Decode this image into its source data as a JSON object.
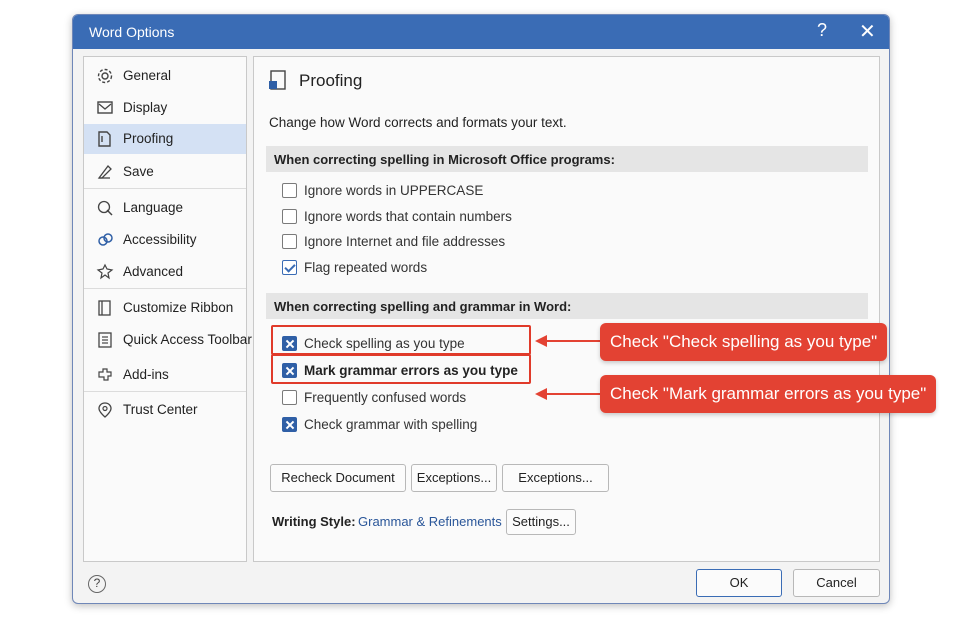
{
  "dialog": {
    "title": "Word Options",
    "help_glyph": "?",
    "close_glyph": "✕"
  },
  "sidebar": {
    "items": [
      {
        "label": "General",
        "icon": "gear-icon"
      },
      {
        "label": "Display",
        "icon": "display-icon"
      },
      {
        "label": "Proofing",
        "icon": "proofing-icon",
        "active": true
      },
      {
        "label": "Save",
        "icon": "save-icon"
      },
      {
        "label": "Language",
        "icon": "language-icon"
      },
      {
        "label": "Accessibility",
        "icon": "accessibility-icon"
      },
      {
        "label": "Advanced",
        "icon": "advanced-icon"
      },
      {
        "label": "Customize Ribbon",
        "icon": "ribbon-icon"
      },
      {
        "label": "Quick Access Toolbar",
        "icon": "toolbar-icon"
      },
      {
        "label": "Add-ins",
        "icon": "addins-icon"
      },
      {
        "label": "Trust Center",
        "icon": "trust-center-icon"
      }
    ]
  },
  "main": {
    "heading": "Proofing",
    "description": "Change how Word corrects and formats your text.",
    "section1": {
      "title": "When correcting spelling in Microsoft Office programs:",
      "options": [
        {
          "label": "Ignore words in UPPERCASE",
          "checked": false
        },
        {
          "label": "Ignore words that contain numbers",
          "checked": false
        },
        {
          "label": "Ignore Internet and file addresses",
          "checked": false
        },
        {
          "label": "Flag repeated words",
          "checked": true
        }
      ]
    },
    "section2": {
      "title": "When correcting spelling and grammar in Word:",
      "options": [
        {
          "label": "Check spelling as you type",
          "checked": true
        },
        {
          "label": "Mark grammar errors as you type",
          "checked": true
        },
        {
          "label": "Frequently confused words",
          "checked": false
        },
        {
          "label": "Check grammar with spelling",
          "checked": true
        }
      ]
    },
    "buttons": {
      "recheck": "Recheck Document",
      "exceptions1": "Exceptions...",
      "exceptions2": "Exceptions..."
    },
    "writing_style": {
      "label": "Writing Style:",
      "value": "Grammar & Refinements",
      "settings": "Settings..."
    }
  },
  "footer": {
    "help_glyph": "?",
    "ok": "OK",
    "cancel": "Cancel"
  },
  "annotations": {
    "callout1": "Check \"Check spelling as you type\"",
    "callout2": "Check \"Mark grammar errors as you type\"",
    "color": "#e34233"
  },
  "colors": {
    "titlebar": "#3a6cb5",
    "accent": "#2f5fa6",
    "active_nav": "#d4e1f4"
  }
}
